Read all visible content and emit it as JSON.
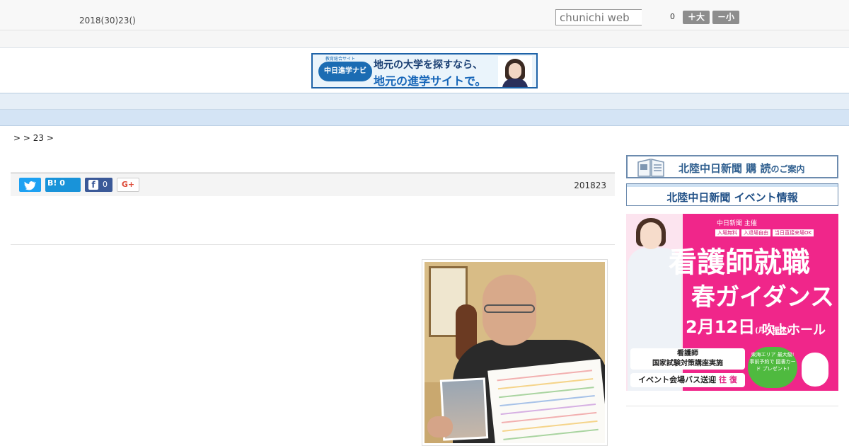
{
  "header": {
    "date": "2018(30)23()",
    "search_placeholder": "chunichi web",
    "font_count": "0",
    "font_big_label": "＋大",
    "font_small_label": "－小"
  },
  "banner": {
    "logo_small": "教育総合サイト",
    "logo": "中日進学ナビ",
    "line1": "地元の大学を探すなら、",
    "line2": "地元の進学サイトで。"
  },
  "nav": {
    "items": [
      "",
      "",
      "",
      "",
      "",
      "",
      "",
      "",
      ""
    ]
  },
  "breadcrumb": ">  > 23 >",
  "share": {
    "hatena_label": "B! 0",
    "facebook_count": "0",
    "gplus_label": "G+",
    "pub_date": "201823"
  },
  "sidebar": {
    "subscribe": {
      "main": "北陸中日新聞 購 読",
      "suffix": "のご案内"
    },
    "events": "北陸中日新聞 イベント情報",
    "ad": {
      "sponsor": "中日新聞 主催",
      "tags": [
        "入場無料",
        "入退場自由",
        "当日直接来場OK"
      ],
      "title1": "看護師就職",
      "title2": "春ガイダンス",
      "date": "2月12日",
      "date_note": "(月・振休)",
      "venue": "吹上ホール",
      "box1_line1": "看護師",
      "box1_line2": "国家試験対策講座実施",
      "box2": "イベント会場バス送迎",
      "box2_accent": "往 復",
      "circle": "東海エリア 最大級! 事前予約で 図書カード プレゼント!"
    }
  },
  "colors": {
    "nav_bg": "#e5eef7",
    "accent_blue": "#1e63a8",
    "ad_pink": "#f0268a",
    "twitter": "#1da1f2",
    "facebook": "#3b5998"
  }
}
